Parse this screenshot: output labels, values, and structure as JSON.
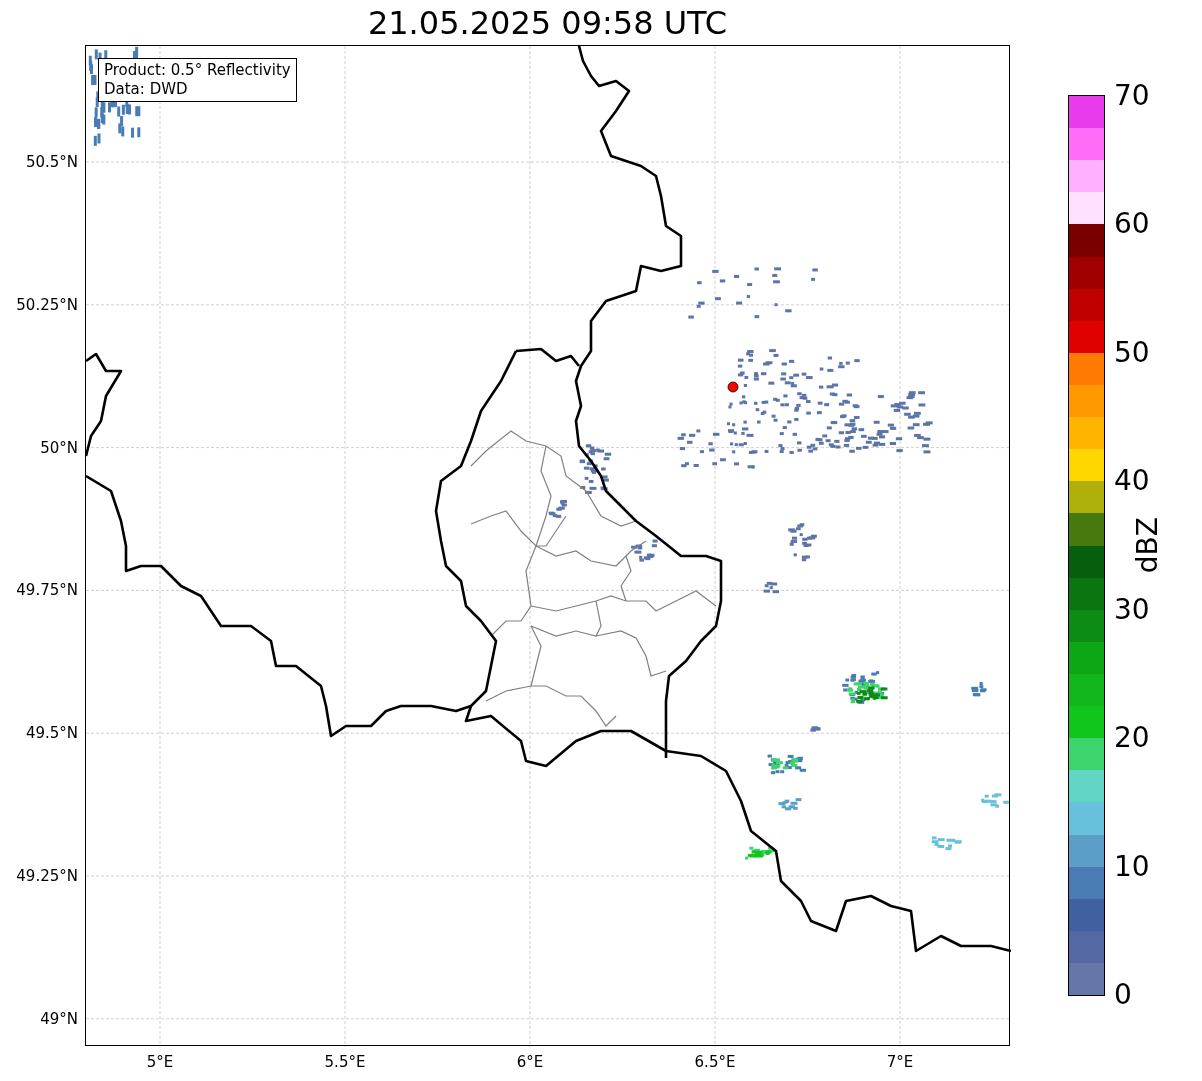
{
  "title": "21.05.2025 09:58 UTC",
  "info_box": [
    "Product: 0.5° Reflectivity",
    "Data: DWD"
  ],
  "map": {
    "y_tick_labels": [
      "50.5°N",
      "50.25°N",
      "50°N",
      "49.75°N",
      "49.5°N",
      "49.25°N",
      "49°N"
    ],
    "x_tick_labels": [
      "5°E",
      "5.5°E",
      "6°E",
      "6.5°E",
      "7°E"
    ]
  },
  "colorbar": {
    "label": "dBZ",
    "ticks": [
      "70",
      "60",
      "50",
      "40",
      "30",
      "20",
      "10",
      "0"
    ],
    "bands": [
      {
        "color": "#e83cec"
      },
      {
        "color": "#ff6cf8"
      },
      {
        "color": "#ffb0ff"
      },
      {
        "color": "#ffe0ff"
      },
      {
        "color": "#7a0000"
      },
      {
        "color": "#a00000"
      },
      {
        "color": "#c00000"
      },
      {
        "color": "#e00000"
      },
      {
        "color": "#ff7a00"
      },
      {
        "color": "#ff9900"
      },
      {
        "color": "#ffb500"
      },
      {
        "color": "#ffd700"
      },
      {
        "color": "#b0b00a"
      },
      {
        "color": "#477a0c"
      },
      {
        "color": "#075e0c"
      },
      {
        "color": "#0b7510"
      },
      {
        "color": "#0c8c12"
      },
      {
        "color": "#0ea614"
      },
      {
        "color": "#11b61a"
      },
      {
        "color": "#10c61c"
      },
      {
        "color": "#3cd46c"
      },
      {
        "color": "#62d6c6"
      },
      {
        "color": "#67c0dc"
      },
      {
        "color": "#5b9fc8"
      },
      {
        "color": "#4a7cb4"
      },
      {
        "color": "#4160a0"
      },
      {
        "color": "#5468a3"
      },
      {
        "color": "#6577a8"
      }
    ]
  }
}
